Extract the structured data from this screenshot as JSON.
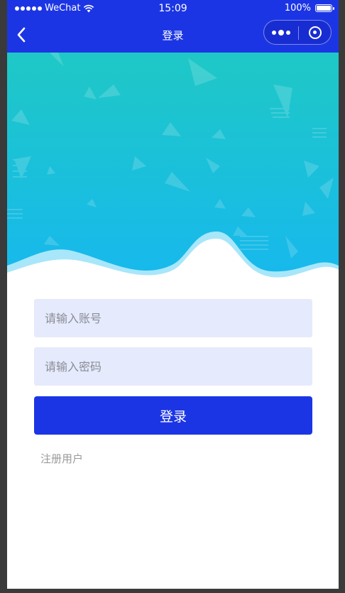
{
  "status_bar": {
    "carrier": "WeChat",
    "time": "15:09",
    "battery": "100%"
  },
  "nav": {
    "title": "登录"
  },
  "form": {
    "account_placeholder": "请输入账号",
    "password_placeholder": "请输入密码",
    "login_label": "登录",
    "register_label": "注册用户"
  },
  "colors": {
    "primary": "#1c35e4",
    "input_bg": "#e5eafc",
    "hero_top": "#1fc8c6",
    "hero_bottom": "#16b8ee"
  }
}
